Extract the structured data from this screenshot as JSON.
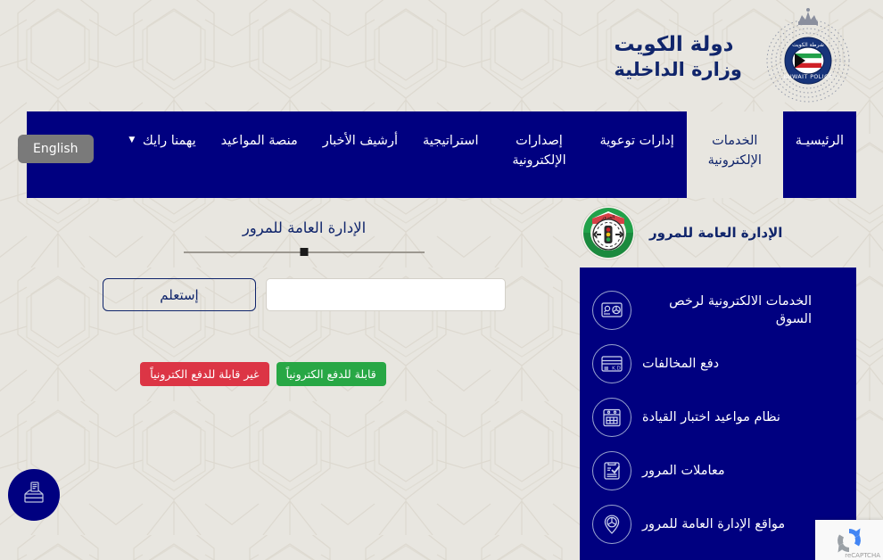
{
  "header": {
    "title_line1": "دولة الكويت",
    "title_line2": "وزارة الداخلية",
    "emblem_name": "kuwait-police-emblem",
    "brand_color": "#10256b"
  },
  "nav": {
    "lang_toggle": "English",
    "items": [
      {
        "label": "الرئيسيـة",
        "active": false,
        "caret": false
      },
      {
        "label": "الخدمات الإلكترونية",
        "active": true,
        "caret": false
      },
      {
        "label": "إدارات توعوية",
        "active": false,
        "caret": false
      },
      {
        "label": "إصدارات الإلكترونية",
        "active": false,
        "caret": false
      },
      {
        "label": "استراتيجية",
        "active": false,
        "caret": false
      },
      {
        "label": "أرشيف الأخبار",
        "active": false,
        "caret": false
      },
      {
        "label": "منصة المواعيد",
        "active": false,
        "caret": false
      },
      {
        "label": "يهمنا رايك",
        "active": false,
        "caret": true
      }
    ],
    "background": "#000080"
  },
  "department": {
    "name": "الإدارة العامة للمرور",
    "logo_name": "traffic-department-logo"
  },
  "sidebar": {
    "background": "#000080",
    "items": [
      {
        "label": "الخدمات الالكترونية لرخص السوق",
        "icon": "driving-license-search-icon"
      },
      {
        "label": "دفع المخالفات",
        "icon": "pay-fines-card-icon"
      },
      {
        "label": "نظام مواعيد اختبار القيادة",
        "icon": "calendar-icon"
      },
      {
        "label": "معاملات المرور",
        "icon": "clipboard-check-icon"
      },
      {
        "label": "مواقع الإدارة العامة للمرور",
        "icon": "location-pin-icon"
      }
    ]
  },
  "main": {
    "panel_title": "الإدارة العامة للمرور",
    "search_value": "",
    "search_placeholder": "",
    "query_button": "إستعلم",
    "legend": {
      "payable_label": "قابلة للدفع الكترونياً",
      "payable_color": "#28a745",
      "nonpayable_label": "غير قابلة للدفع الكترونياً",
      "nonpayable_color": "#dc3545"
    }
  },
  "widgets": {
    "feedback_fab_name": "suggestion-box-icon",
    "recaptcha_label": "reCAPTCHA"
  }
}
